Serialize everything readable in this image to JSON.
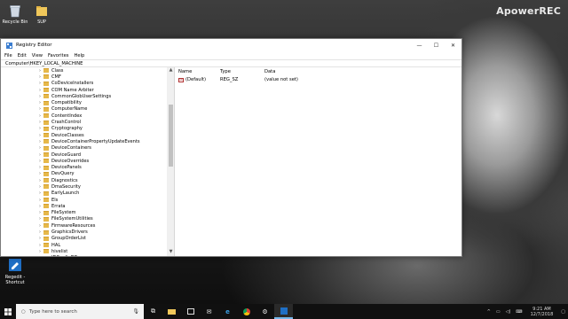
{
  "desktop": {
    "icons": [
      {
        "label": "Recycle Bin",
        "icon": "recycle-bin-icon"
      },
      {
        "label": "SUP",
        "icon": "folder-icon"
      }
    ],
    "bottom_icon_label": "Regedit - Shortcut",
    "watermark": "ApowerREC"
  },
  "window": {
    "title": "Registry Editor",
    "menu": [
      "File",
      "Edit",
      "View",
      "Favorites",
      "Help"
    ],
    "address": "Computer\\HKEY_LOCAL_MACHINE"
  },
  "tree": {
    "items": [
      "Class",
      "CMF",
      "CoDeviceInstallers",
      "COM Name Arbiter",
      "CommonGlobUserSettings",
      "Compatibility",
      "ComputerName",
      "ContentIndex",
      "CrashControl",
      "Cryptography",
      "DeviceClasses",
      "DeviceContainerPropertyUpdateEvents",
      "DeviceContainers",
      "DeviceGuard",
      "DeviceOverrides",
      "DevicePanels",
      "DevQuery",
      "Diagnostics",
      "DmaSecurity",
      "EarlyLaunch",
      "Els",
      "Errata",
      "FileSystem",
      "FileSystemUtilities",
      "FirmwareResources",
      "GraphicsDrivers",
      "GroupOrderList",
      "HAL",
      "hivelist",
      "IDConfigDB"
    ]
  },
  "details": {
    "headers": [
      "Name",
      "Type",
      "Data"
    ],
    "rows": [
      {
        "name": "(Default)",
        "type": "REG_SZ",
        "data": "(value not set)"
      }
    ]
  },
  "taskbar": {
    "search_placeholder": "Type here to search",
    "time": "9:21 AM",
    "date": "12/7/2018"
  },
  "colors": {
    "folder": "#e6b84a",
    "taskbar": "#101010",
    "accent": "#76b9ed"
  }
}
